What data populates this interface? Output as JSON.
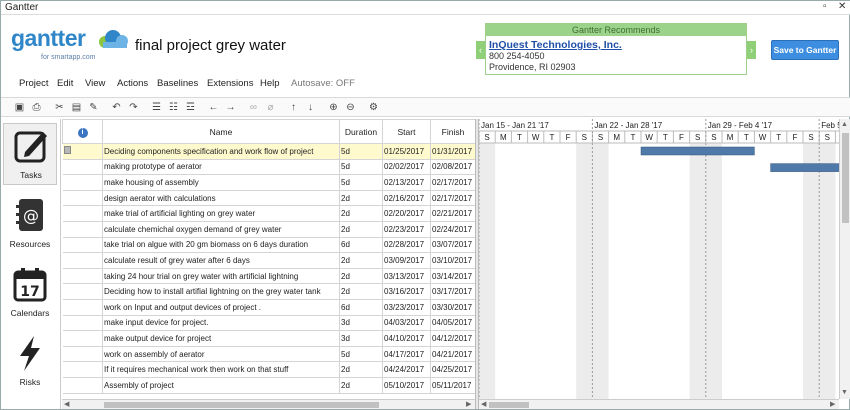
{
  "window": {
    "title": "Gantter",
    "restore": "▫",
    "close": "✕"
  },
  "brand": {
    "logo_text": "gantter",
    "logo_sub": "for smartapp.com"
  },
  "project": {
    "title": "final project grey water"
  },
  "recommend": {
    "header": "Gantter Recommends",
    "company": "InQuest Technologies, Inc.",
    "phone": "800 254-4050",
    "address": "Providence, RI 02903"
  },
  "save_button": "Save to Gantter",
  "menu": [
    "Project",
    "Edit",
    "View",
    "Actions",
    "Baselines",
    "Extensions",
    "Help"
  ],
  "autosave": "Autosave: OFF",
  "nav": [
    {
      "label": "Tasks",
      "icon": "tasks-edit-icon",
      "active": true
    },
    {
      "label": "Resources",
      "icon": "resources-addressbook-icon",
      "active": false
    },
    {
      "label": "Calendars",
      "icon": "calendar-icon",
      "active": false,
      "day": "17"
    },
    {
      "label": "Risks",
      "icon": "risks-lightning-icon",
      "active": false
    }
  ],
  "grid": {
    "columns": {
      "info": "i",
      "name": "Name",
      "duration": "Duration",
      "start": "Start",
      "finish": "Finish"
    },
    "rows": [
      {
        "name": "Deciding components specification and work flow of project",
        "duration": "5d",
        "start": "01/25/2017",
        "finish": "01/31/2017"
      },
      {
        "name": "making prototype of aerator",
        "duration": "5d",
        "start": "02/02/2017",
        "finish": "02/08/2017"
      },
      {
        "name": "make housing of assembly",
        "duration": "5d",
        "start": "02/13/2017",
        "finish": "02/17/2017"
      },
      {
        "name": "design aerator with calculations",
        "duration": "2d",
        "start": "02/16/2017",
        "finish": "02/17/2017"
      },
      {
        "name": "make trial of artificial lighting on grey water",
        "duration": "2d",
        "start": "02/20/2017",
        "finish": "02/21/2017"
      },
      {
        "name": "calculate chemichal oxygen demand of grey water",
        "duration": "2d",
        "start": "02/23/2017",
        "finish": "02/24/2017"
      },
      {
        "name": "take trial on algue with 20 gm biomass on 6 days duration",
        "duration": "6d",
        "start": "02/28/2017",
        "finish": "03/07/2017"
      },
      {
        "name": "calculate result of grey water after 6 days",
        "duration": "2d",
        "start": "03/09/2017",
        "finish": "03/10/2017"
      },
      {
        "name": "taking 24 hour trial on grey water with artificial lightning",
        "duration": "2d",
        "start": "03/13/2017",
        "finish": "03/14/2017"
      },
      {
        "name": "Deciding how to install artifial lightning on the grey water tank",
        "duration": "2d",
        "start": "03/16/2017",
        "finish": "03/17/2017"
      },
      {
        "name": "work on Input and output devices of project .",
        "duration": "6d",
        "start": "03/23/2017",
        "finish": "03/30/2017"
      },
      {
        "name": "make input device for project.",
        "duration": "3d",
        "start": "04/03/2017",
        "finish": "04/05/2017"
      },
      {
        "name": "make output device for project",
        "duration": "3d",
        "start": "04/10/2017",
        "finish": "04/12/2017"
      },
      {
        "name": "work on assembly of aerator",
        "duration": "5d",
        "start": "04/17/2017",
        "finish": "04/21/2017"
      },
      {
        "name": "If it requires mechanical work then work on that stuff",
        "duration": "2d",
        "start": "04/24/2017",
        "finish": "04/25/2017"
      },
      {
        "name": "Assembly of project",
        "duration": "2d",
        "start": "05/10/2017",
        "finish": "05/11/2017"
      }
    ]
  },
  "gantt": {
    "weeks": [
      "Jan 15 - Jan 21 '17",
      "Jan 22 - Jan 28 '17",
      "Jan 29 - Feb 4 '17",
      "Feb 5"
    ],
    "days": [
      "S",
      "M",
      "T",
      "W",
      "T",
      "F",
      "S"
    ],
    "bar_color": "#4e79a8"
  },
  "colors": {
    "selected_row": "#fffacd",
    "save_button": "#3d8ee0",
    "recommend_green": "#9bd38b"
  }
}
